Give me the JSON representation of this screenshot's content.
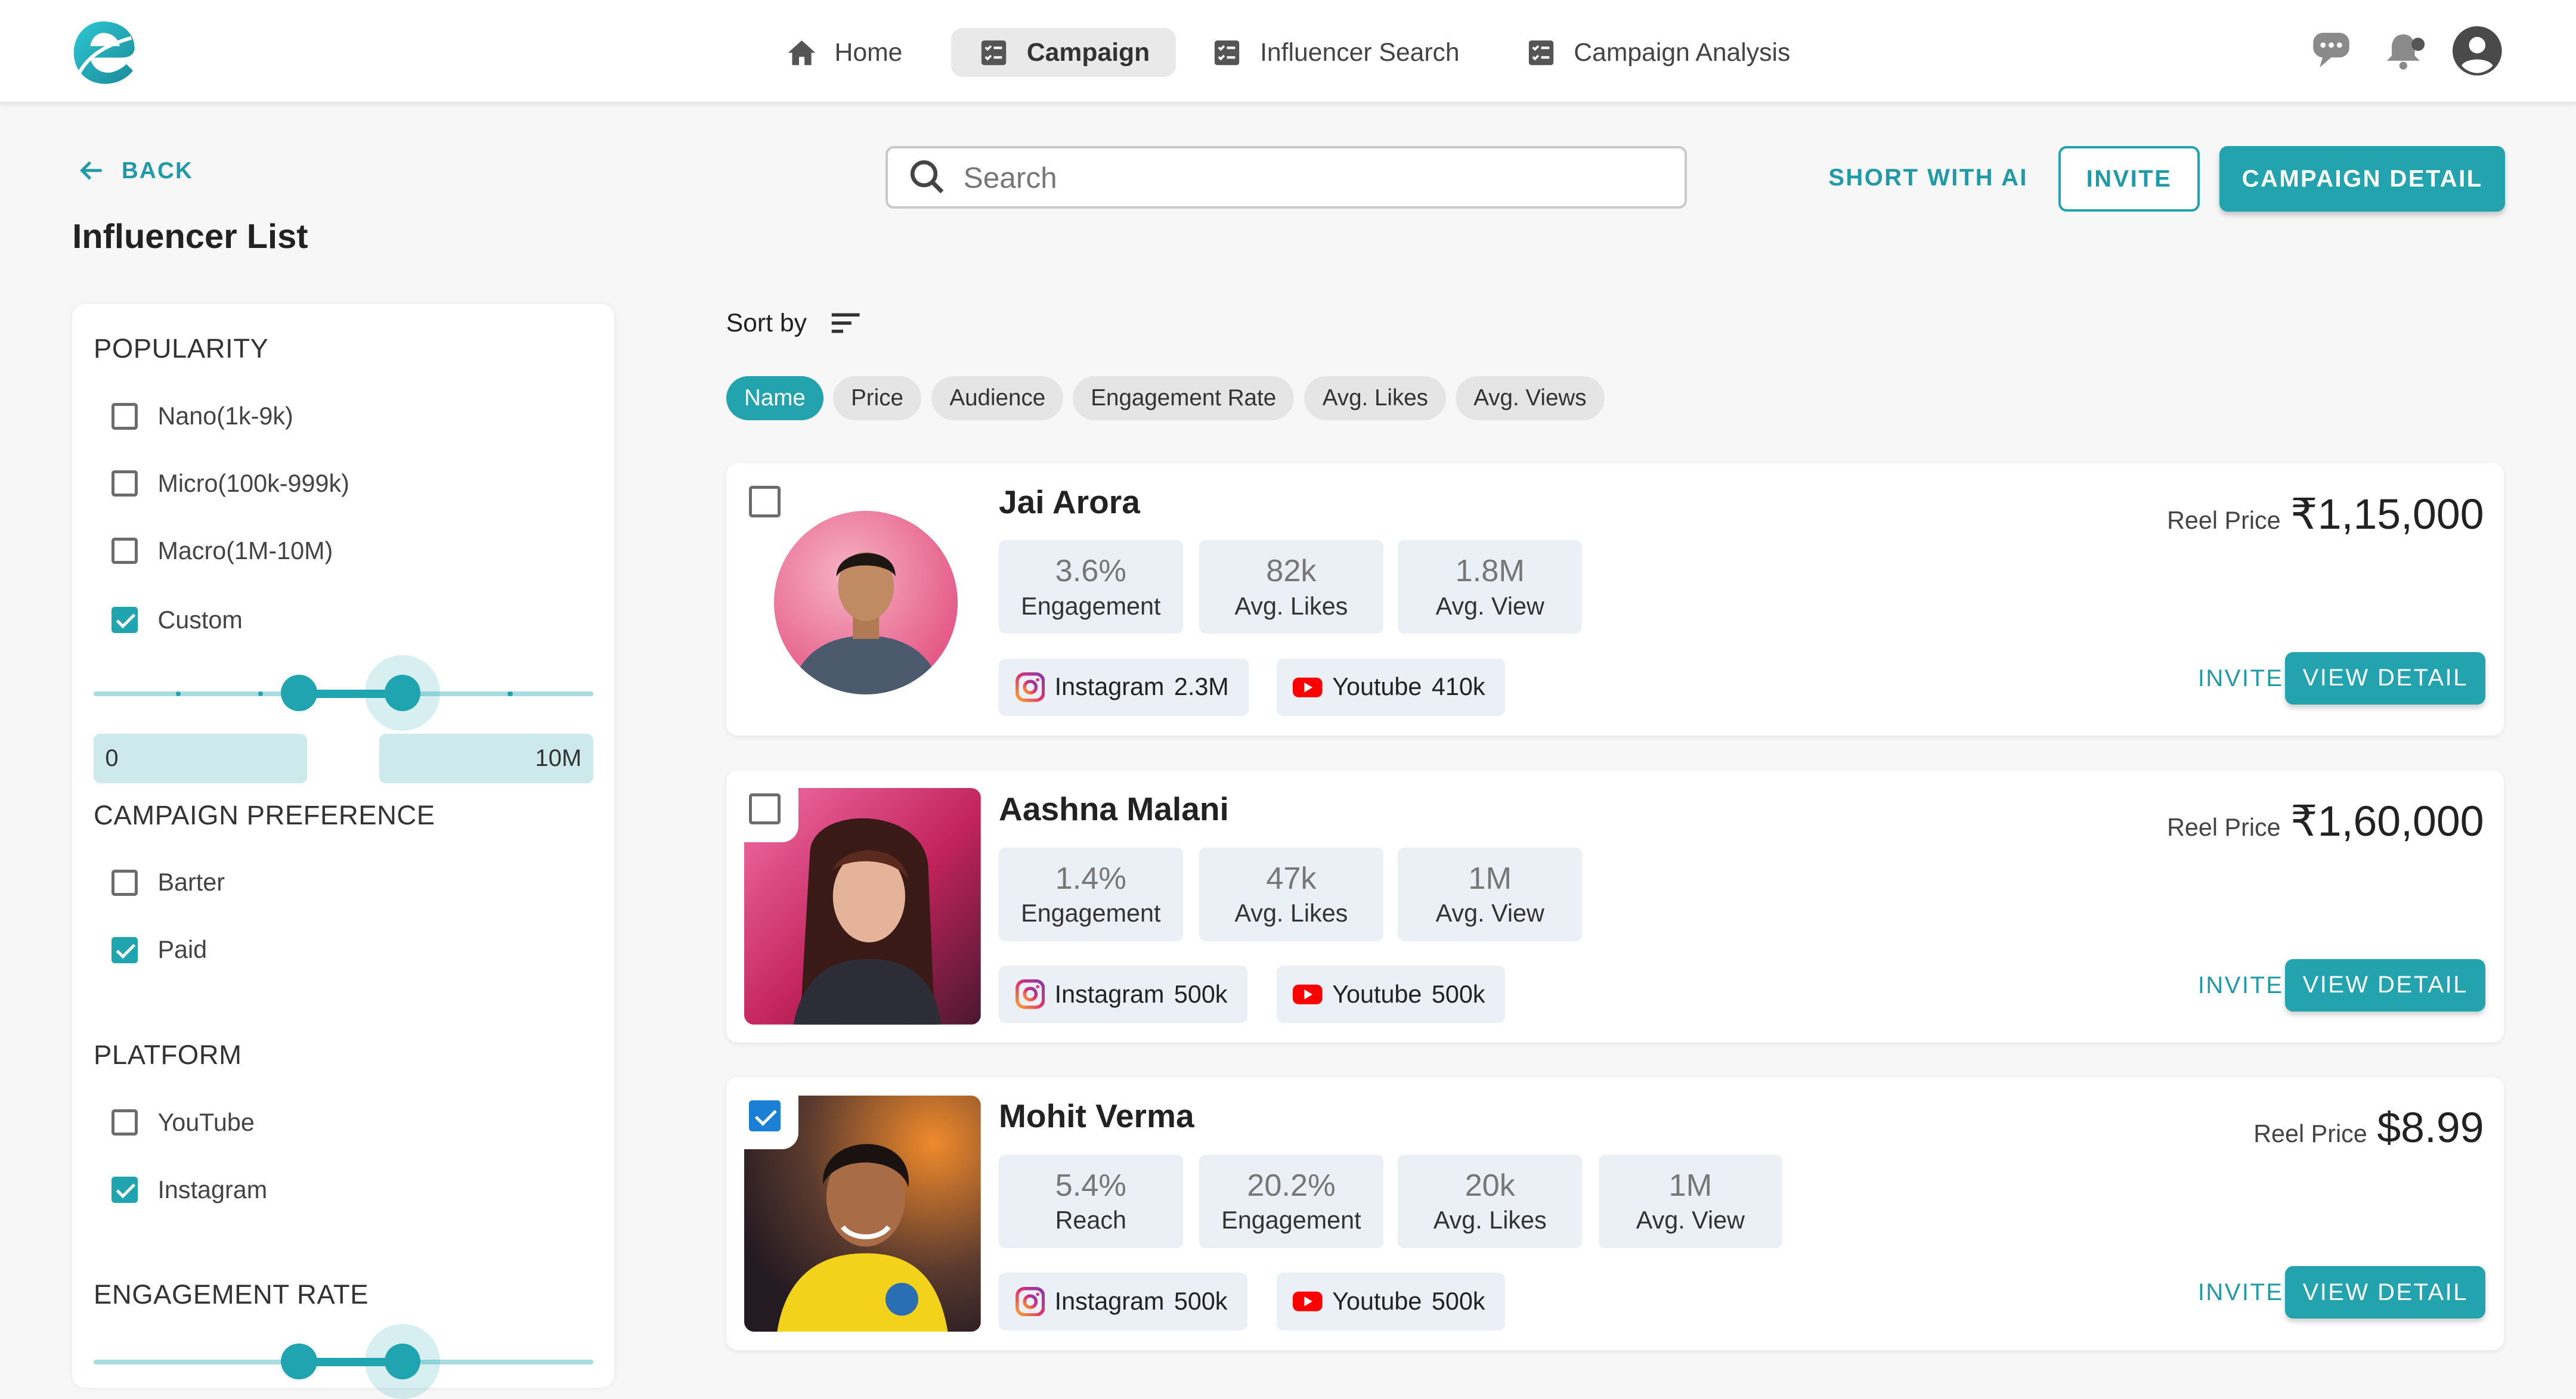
{
  "nav": {
    "items": [
      {
        "label": "Home",
        "icon": "home-icon"
      },
      {
        "label": "Campaign",
        "icon": "checklist-icon",
        "active": true
      },
      {
        "label": "Influencer Search",
        "icon": "checklist-icon"
      },
      {
        "label": "Campaign Analysis",
        "icon": "checklist-icon"
      }
    ],
    "right_icons": [
      "chat-icon",
      "notification-icon",
      "account-icon"
    ]
  },
  "back_label": "BACK",
  "page_title": "Influencer List",
  "search": {
    "placeholder": "Search",
    "value": ""
  },
  "actions": {
    "short_ai": "SHORT  WITH AI",
    "invite": "INVITE",
    "campaign_detail": "CAMPAIGN DETAIL"
  },
  "filters": {
    "popularity": {
      "title": "POPULARITY",
      "options": [
        {
          "label": "Nano(1k-9k)",
          "checked": false
        },
        {
          "label": "Micro(100k-999k)",
          "checked": false
        },
        {
          "label": "Macro(1M-10M)",
          "checked": false
        },
        {
          "label": "Custom",
          "checked": true
        }
      ],
      "range_min": "0",
      "range_max": "10M"
    },
    "campaign_pref": {
      "title": "CAMPAIGN PREFERENCE",
      "options": [
        {
          "label": "Barter",
          "checked": false
        },
        {
          "label": "Paid",
          "checked": true
        }
      ]
    },
    "platform": {
      "title": "PLATFORM",
      "options": [
        {
          "label": "YouTube",
          "checked": false
        },
        {
          "label": "Instagram",
          "checked": true
        }
      ]
    },
    "engagement": {
      "title": "ENGAGEMENT RATE"
    }
  },
  "sort": {
    "label": "Sort by",
    "chips": [
      {
        "label": "Name",
        "active": true
      },
      {
        "label": "Price"
      },
      {
        "label": "Audience"
      },
      {
        "label": "Engagement Rate"
      },
      {
        "label": "Avg. Likes"
      },
      {
        "label": "Avg. Views"
      }
    ]
  },
  "influencers": [
    {
      "name": "Jai Arora",
      "checked": false,
      "stats": [
        {
          "value": "3.6%",
          "label": "Engagement"
        },
        {
          "value": "82k",
          "label": "Avg. Likes"
        },
        {
          "value": "1.8M",
          "label": "Avg. View"
        }
      ],
      "instagram": {
        "label": "Instagram",
        "count": "2.3M"
      },
      "youtube": {
        "label": "Youtube",
        "count": "410k"
      },
      "price_label": "Reel Price",
      "price": "₹1,15,000",
      "invite": "INVITE",
      "view_detail": "VIEW DETAIL"
    },
    {
      "name": "Aashna Malani",
      "checked": false,
      "stats": [
        {
          "value": "1.4%",
          "label": "Engagement"
        },
        {
          "value": "47k",
          "label": "Avg. Likes"
        },
        {
          "value": "1M",
          "label": "Avg. View"
        }
      ],
      "instagram": {
        "label": "Instagram",
        "count": "500k"
      },
      "youtube": {
        "label": "Youtube",
        "count": "500k"
      },
      "price_label": "Reel Price",
      "price": "₹1,60,000",
      "invite": "INVITE",
      "view_detail": "VIEW DETAIL"
    },
    {
      "name": "Mohit Verma",
      "checked": true,
      "stats": [
        {
          "value": "5.4%",
          "label": "Reach"
        },
        {
          "value": "20.2%",
          "label": "Engagement"
        },
        {
          "value": "20k",
          "label": "Avg. Likes"
        },
        {
          "value": "1M",
          "label": "Avg. View"
        }
      ],
      "instagram": {
        "label": "Instagram",
        "count": "500k"
      },
      "youtube": {
        "label": "Youtube",
        "count": "500k"
      },
      "price_label": "Reel Price",
      "price": "$8.99",
      "invite": "INVITE",
      "view_detail": "VIEW DETAIL"
    }
  ],
  "colors": {
    "accent": "#23a3ad",
    "accent_text": "#1f9aa6",
    "checkbox_blue": "#1b7fd6"
  }
}
